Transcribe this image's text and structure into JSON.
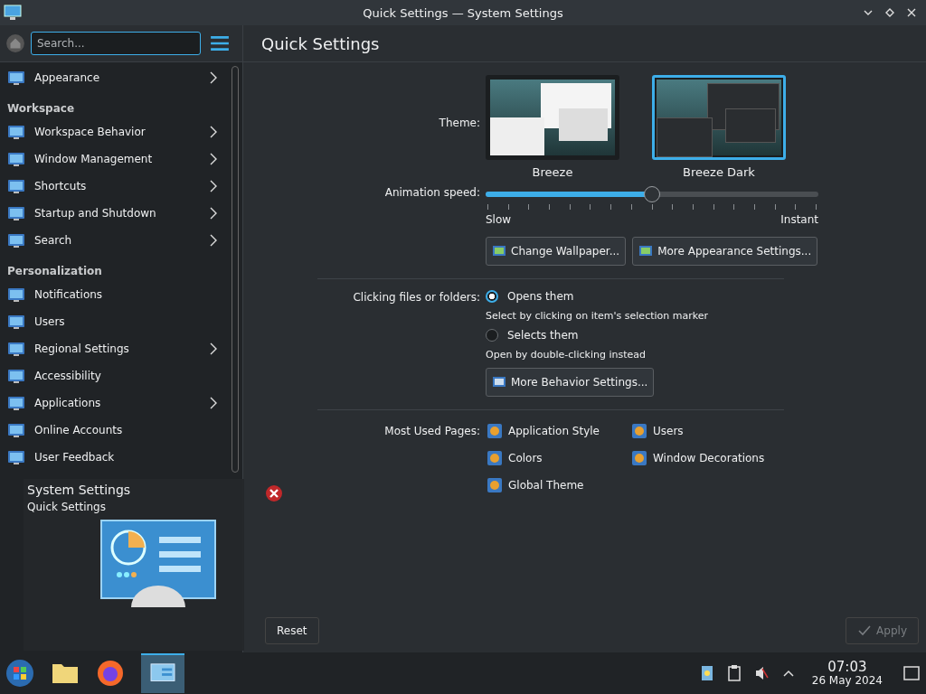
{
  "window": {
    "title": "Quick Settings — System Settings"
  },
  "sidebar": {
    "search": {
      "placeholder": "Search..."
    },
    "items": [
      {
        "kind": "item",
        "label": "Appearance",
        "has_children": true
      },
      {
        "kind": "heading",
        "label": "Workspace"
      },
      {
        "kind": "item",
        "label": "Workspace Behavior",
        "has_children": true
      },
      {
        "kind": "item",
        "label": "Window Management",
        "has_children": true
      },
      {
        "kind": "item",
        "label": "Shortcuts",
        "has_children": true
      },
      {
        "kind": "item",
        "label": "Startup and Shutdown",
        "has_children": true
      },
      {
        "kind": "item",
        "label": "Search",
        "has_children": true
      },
      {
        "kind": "heading",
        "label": "Personalization"
      },
      {
        "kind": "item",
        "label": "Notifications",
        "has_children": false
      },
      {
        "kind": "item",
        "label": "Users",
        "has_children": false
      },
      {
        "kind": "item",
        "label": "Regional Settings",
        "has_children": true
      },
      {
        "kind": "item",
        "label": "Accessibility",
        "has_children": false
      },
      {
        "kind": "item",
        "label": "Applications",
        "has_children": true
      },
      {
        "kind": "item",
        "label": "Online Accounts",
        "has_children": false
      },
      {
        "kind": "item",
        "label": "User Feedback",
        "has_children": false
      }
    ]
  },
  "page": {
    "title": "Quick Settings",
    "theme": {
      "label": "Theme:",
      "options": [
        {
          "name": "Breeze",
          "dark": false,
          "selected": false
        },
        {
          "name": "Breeze Dark",
          "dark": true,
          "selected": true
        }
      ]
    },
    "animation": {
      "label": "Animation speed:",
      "level": 0.5,
      "min_label": "Slow",
      "max_label": "Instant"
    },
    "appearance_buttons": [
      "Change Wallpaper...",
      "More Appearance Settings..."
    ],
    "clicking": {
      "label": "Clicking files or folders:",
      "options": [
        {
          "label": "Opens them",
          "hint": "Select by clicking on item's selection marker",
          "selected": true
        },
        {
          "label": "Selects them",
          "hint": "Open by double-clicking instead",
          "selected": false
        }
      ]
    },
    "behavior_button": "More Behavior Settings...",
    "most_used": {
      "label": "Most Used Pages:",
      "pages": [
        "Application Style",
        "Users",
        "Colors",
        "Window Decorations",
        "Global Theme"
      ]
    },
    "footer": {
      "reset": "Reset",
      "apply": "Apply",
      "apply_disabled": true
    }
  },
  "task_preview": {
    "title": "System Settings",
    "subtitle": "Quick Settings"
  },
  "taskbar": {
    "clock": {
      "time": "07:03",
      "date": "26 May 2024"
    }
  }
}
